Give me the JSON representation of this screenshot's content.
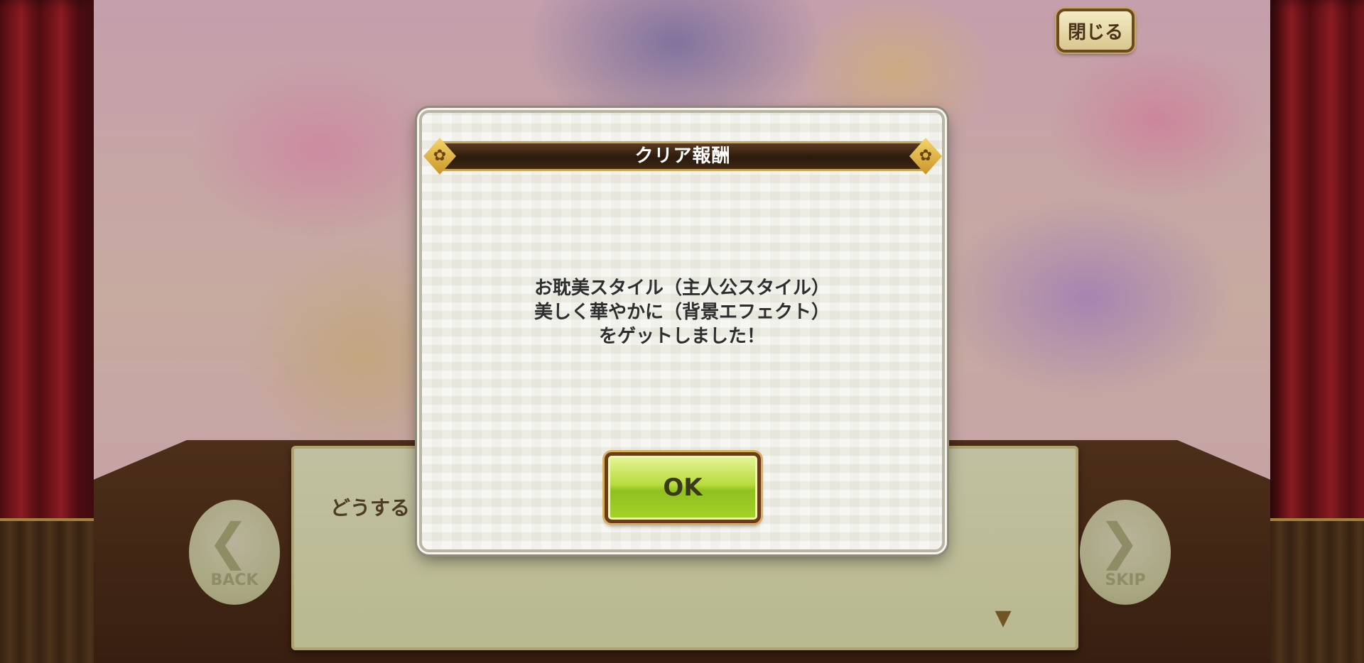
{
  "header": {
    "close_label": "閉じる"
  },
  "story": {
    "dialog_text": "どうする",
    "back_label": "BACK",
    "skip_label": "SKIP"
  },
  "modal": {
    "title": "クリア報酬",
    "message_lines": [
      "お耽美スタイル（主人公スタイル）",
      "美しく華やかに（背景エフェクト）",
      "をゲットしました！"
    ],
    "ok_label": "OK"
  },
  "colors": {
    "title_bar": "#2c1a0c",
    "ok_button": "#a6d22a",
    "curtain": "#8a1a1f",
    "dialog_panel": "#e4ebb3"
  }
}
